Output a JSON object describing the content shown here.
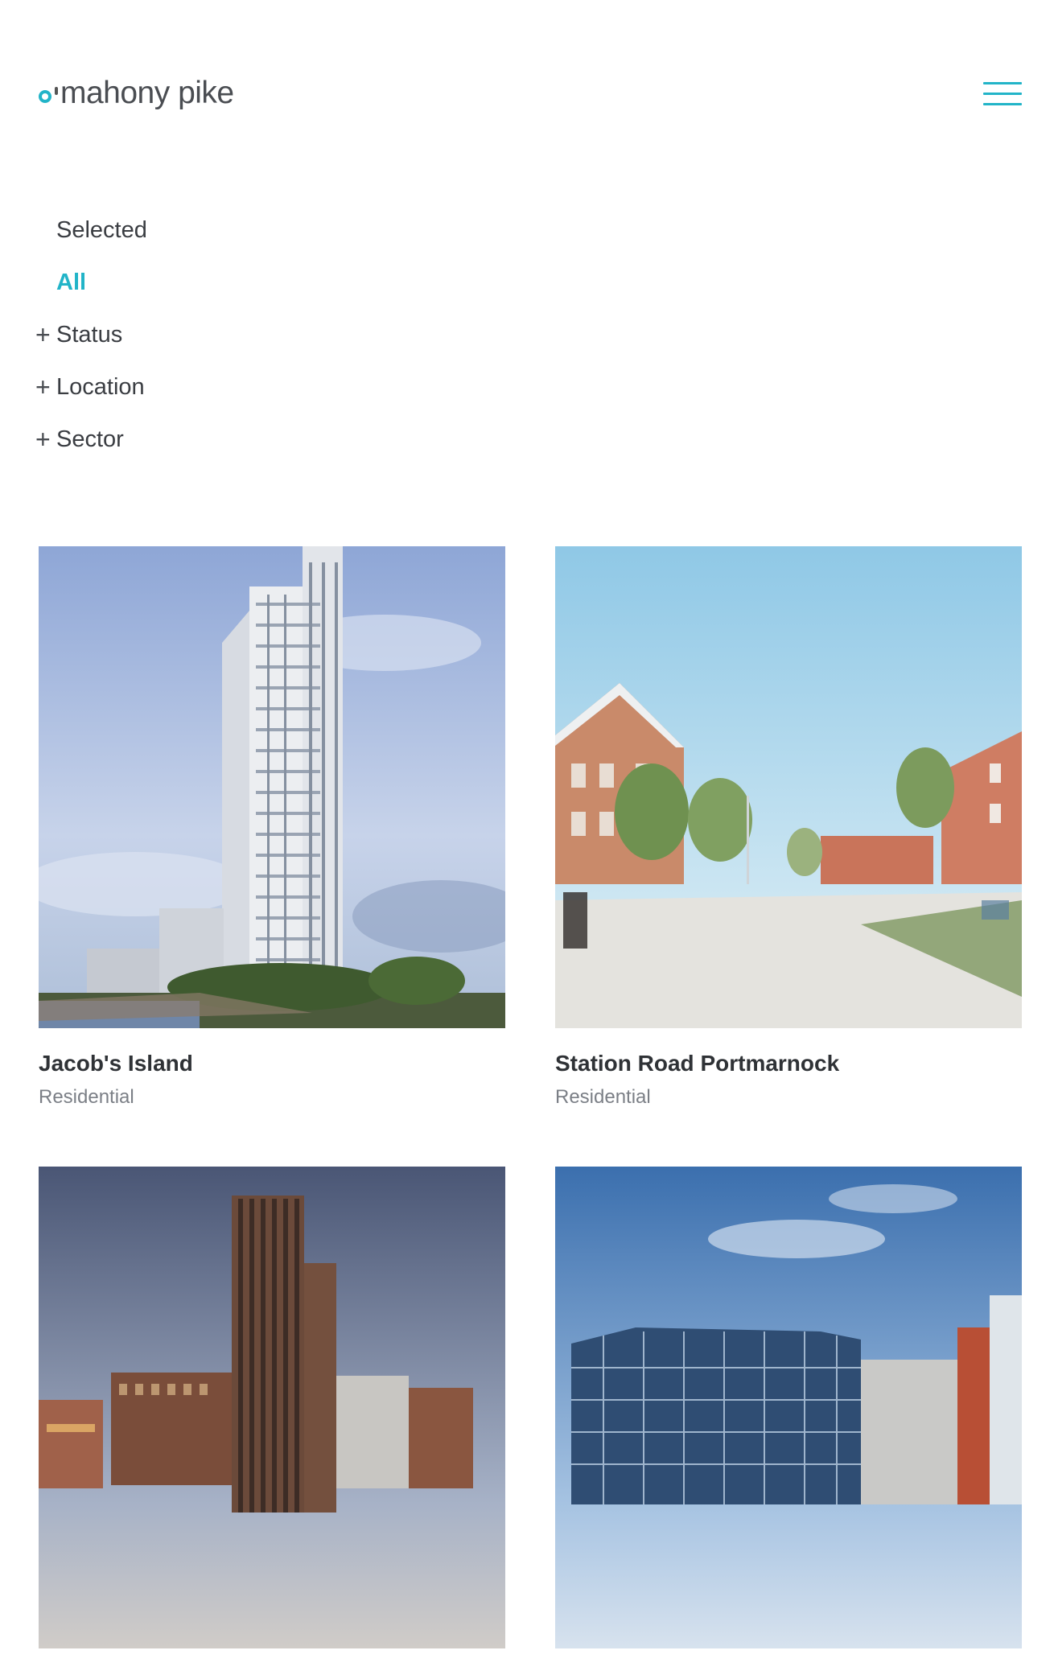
{
  "header": {
    "logo_text": "mahony pike",
    "menu_icon": "hamburger-menu-icon"
  },
  "filters": {
    "selected": "Selected",
    "all": "All",
    "status": "Status",
    "location": "Location",
    "sector": "Sector",
    "expand_icon": "plus-icon"
  },
  "colors": {
    "accent": "#22b4c8",
    "text": "#3a3d42",
    "muted": "#7b7f86"
  },
  "projects": [
    {
      "title": "Jacob's Island",
      "sector": "Residential"
    },
    {
      "title": "Station Road Portmarnock",
      "sector": "Residential"
    },
    {
      "title": "",
      "sector": ""
    },
    {
      "title": "",
      "sector": ""
    }
  ]
}
